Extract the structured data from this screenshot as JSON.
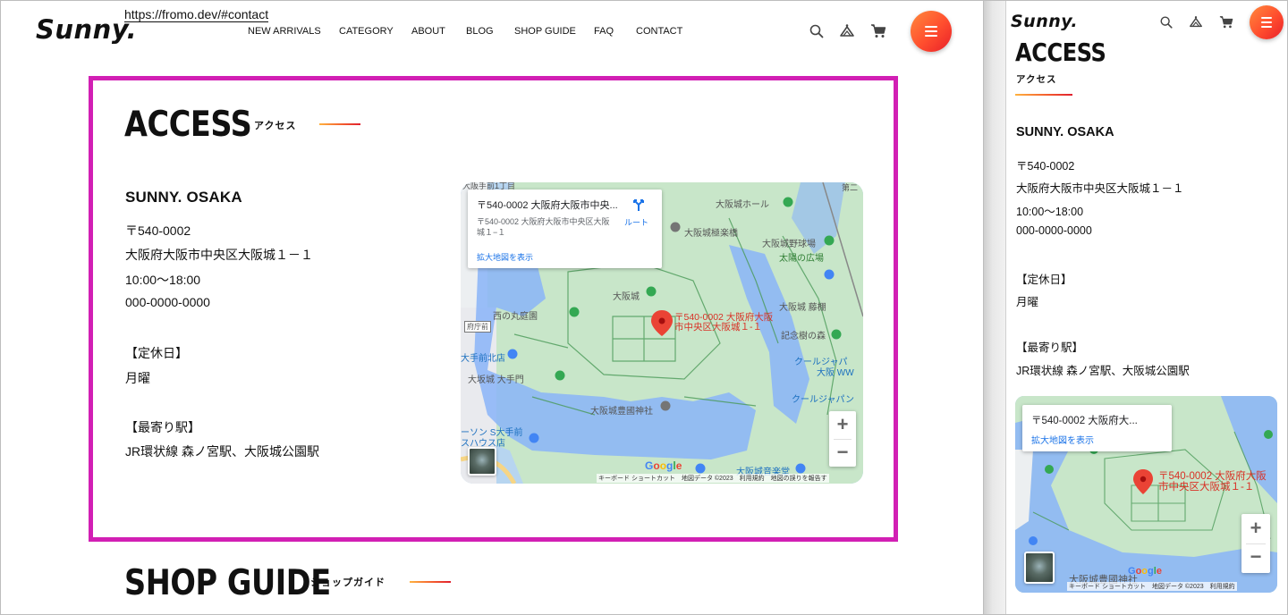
{
  "annotation_url": "https://fromo.dev/#contact",
  "brand": {
    "logo": "Sunny."
  },
  "nav": [
    "NEW ARRIVALS",
    "CATEGORY",
    "ABOUT",
    "BLOG",
    "SHOP GUIDE",
    "FAQ",
    "CONTACT"
  ],
  "access": {
    "title": "ACCESS",
    "subtitle": "アクセス",
    "shop_name": "SUNNY. OSAKA",
    "postal": "〒540-0002",
    "address": "大阪府大阪市中央区大阪城１－１",
    "hours": "10:00〜18:00",
    "phone": "000-0000-0000",
    "holiday_label": "【定休日】",
    "holiday": "月曜",
    "station_label": "【最寄り駅】",
    "station": "JR環状線 森ノ宮駅、大阪城公園駅"
  },
  "map": {
    "card_title": "〒540-0002 大阪府大阪市中央...",
    "card_title_mobile": "〒540-0002 大阪府大...",
    "card_address": "〒540-0002 大阪府大阪市中央区大阪城１−１",
    "route_label": "ルート",
    "enlarge_link": "拡大地図を表示",
    "pin_label_1": "〒540-0002 大阪府大阪",
    "pin_label_2": "市中央区大阪城１-１",
    "pin_label_m1": "〒540-0002 大阪府大阪",
    "pin_label_m2": "市中央区大阪城１-１",
    "zoom_in": "+",
    "zoom_out": "−",
    "google": "Google",
    "attribution": "キーボード ショートカット　地図データ ©2023　利用規約　地図の誤りを報告す",
    "attribution_mobile": "キーボード ショートカット　地図データ ©2023　利用規約",
    "places": {
      "hall": "大阪城ホール",
      "gokuraku": "大阪城極楽橋",
      "stadium": "大阪城野球場",
      "taiyo": "太陽の広場",
      "castle": "大阪城",
      "fujidana": "大阪城 藤棚",
      "nishinomaru": "西の丸庭園",
      "fuchomae": "府庁前",
      "kinen": "記念樹の森",
      "otemae_kita": "大手前北店",
      "otemon": "大坂城 大手門",
      "jinja": "大阪城豊國神社",
      "cool_1": "クールジャパ",
      "cool_2": "大阪 WW",
      "cool_3": "クールジャパン",
      "lawson_1": "ーソン S大手前",
      "lawson_2": "スハウス店",
      "ongaku": "大阪城音楽堂",
      "top_left": "大阪手前1丁目",
      "top_right": "第二"
    }
  },
  "shop_guide": {
    "title": "SHOP GUIDE",
    "subtitle": "ショップガイド"
  },
  "colors": {
    "highlight": "#d21fb4",
    "accent_start": "#ff8a3d",
    "accent_end": "#e8202a",
    "map_water": "#b9d9f3",
    "map_park": "#c8e6c9"
  }
}
